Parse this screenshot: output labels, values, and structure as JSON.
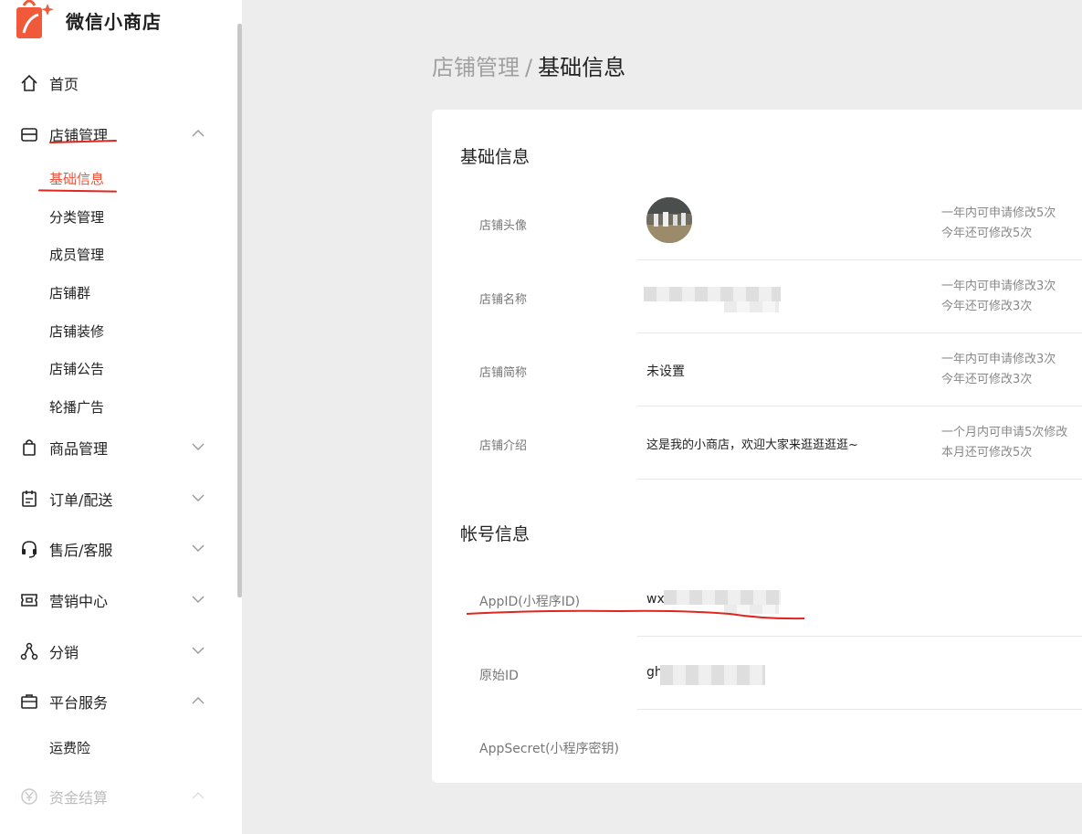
{
  "app": {
    "name": "微信小商店",
    "brand_color": "#f05a3a"
  },
  "sidebar": {
    "items": [
      {
        "label": "首页",
        "icon": "home-icon"
      },
      {
        "label": "店铺管理",
        "icon": "shop-icon",
        "expanded": true,
        "children": [
          "基础信息",
          "分类管理",
          "成员管理",
          "店铺群",
          "店铺装修",
          "店铺公告",
          "轮播广告"
        ],
        "active_child": "基础信息"
      },
      {
        "label": "商品管理",
        "icon": "bag-icon"
      },
      {
        "label": "订单/配送",
        "icon": "clipboard-icon"
      },
      {
        "label": "售后/客服",
        "icon": "headset-icon"
      },
      {
        "label": "营销中心",
        "icon": "ticket-icon"
      },
      {
        "label": "分销",
        "icon": "share-nodes-icon"
      },
      {
        "label": "平台服务",
        "icon": "briefcase-icon",
        "expanded": true,
        "children": [
          "运费险"
        ]
      },
      {
        "label": "资金结算",
        "icon": "yen-icon",
        "disabled": true
      }
    ]
  },
  "breadcrumb": {
    "parent": "店铺管理",
    "separator": "/",
    "current": "基础信息"
  },
  "basic_info": {
    "title": "基础信息",
    "rows": [
      {
        "label": "店铺头像",
        "value": "",
        "note1": "一年内可申请修改5次",
        "note2": "今年还可修改5次"
      },
      {
        "label": "店铺名称",
        "value": "",
        "note1": "一年内可申请修改3次",
        "note2": "今年还可修改3次"
      },
      {
        "label": "店铺简称",
        "value": "未设置",
        "note1": "一年内可申请修改3次",
        "note2": "今年还可修改3次"
      },
      {
        "label": "店铺介绍",
        "value": "这是我的小商店，欢迎大家来逛逛逛逛~",
        "note1": "一个月内可申请5次修改",
        "note2": "本月还可修改5次"
      }
    ]
  },
  "account_info": {
    "title": "帐号信息",
    "rows": [
      {
        "label": "AppID(小程序ID)",
        "value": "wx"
      },
      {
        "label": "原始ID",
        "value": "gh"
      },
      {
        "label": "AppSecret(小程序密钥)",
        "value": ""
      }
    ]
  },
  "annotation_color": "#e0261f"
}
